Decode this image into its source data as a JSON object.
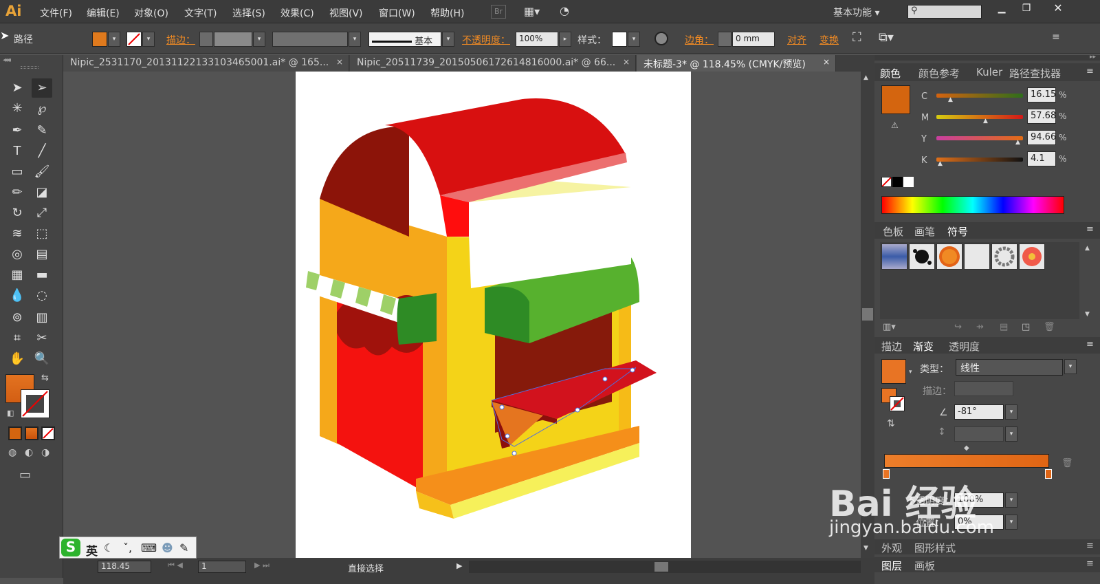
{
  "app": {
    "logo": "Ai",
    "workspace": "基本功能",
    "br_label": "Br"
  },
  "menu": [
    "文件(F)",
    "编辑(E)",
    "对象(O)",
    "文字(T)",
    "选择(S)",
    "效果(C)",
    "视图(V)",
    "窗口(W)",
    "帮助(H)"
  ],
  "control": {
    "selection_label": "路径",
    "stroke_label": "描边：",
    "stroke_profile": "基本",
    "opacity_label": "不透明度：",
    "opacity_value": "100%",
    "style_label": "样式：",
    "corner_label": "边角：",
    "corner_value": "0 mm",
    "align_label": "对齐",
    "transform_label": "变换"
  },
  "tabs": [
    {
      "label": "Nipic_2531170_20131122133103465001.ai* @ 165...",
      "close": "×"
    },
    {
      "label": "Nipic_20511739_20150506172614816000.ai* @ 66...",
      "close": "×"
    },
    {
      "label": "未标题-3* @ 118.45% (CMYK/预览)",
      "close": "×"
    }
  ],
  "color_panel": {
    "tabs": [
      "颜色",
      "颜色参考",
      "Kuler",
      "路径查找器"
    ],
    "channels": [
      {
        "name": "C",
        "value": "16.15",
        "pct": "%",
        "level": 0.16
      },
      {
        "name": "M",
        "value": "57.68",
        "pct": "%",
        "level": 0.58
      },
      {
        "name": "Y",
        "value": "94.66",
        "pct": "%",
        "level": 0.95
      },
      {
        "name": "K",
        "value": "4.1",
        "pct": "%",
        "level": 0.04
      }
    ],
    "fill_color": "#d4650f"
  },
  "swatch_panel": {
    "tabs": [
      "色板",
      "画笔",
      "符号"
    ]
  },
  "gradient_panel": {
    "tabs": [
      "描边",
      "渐变",
      "透明度"
    ],
    "type_label": "类型：",
    "type_value": "线性",
    "stroke_label": "描边：",
    "angle_value": "-81°",
    "opacity_label": "不透明度：",
    "opacity_value": "100%",
    "position_label": "位置：",
    "position_value": "0%"
  },
  "appearance_panel": {
    "tabs": [
      "外观",
      "图形样式"
    ]
  },
  "layers_panel": {
    "tabs": [
      "图层",
      "画板"
    ]
  },
  "status": {
    "zoom": "118.45",
    "page": "1",
    "tool": "直接选择"
  },
  "ime": {
    "lang": "英"
  },
  "watermark": {
    "brand": "Bai 经验",
    "url": "jingyan.baidu.com"
  },
  "colors": {
    "accent": "#f08a24",
    "fill": "#d4650f",
    "panel": "#474747"
  }
}
